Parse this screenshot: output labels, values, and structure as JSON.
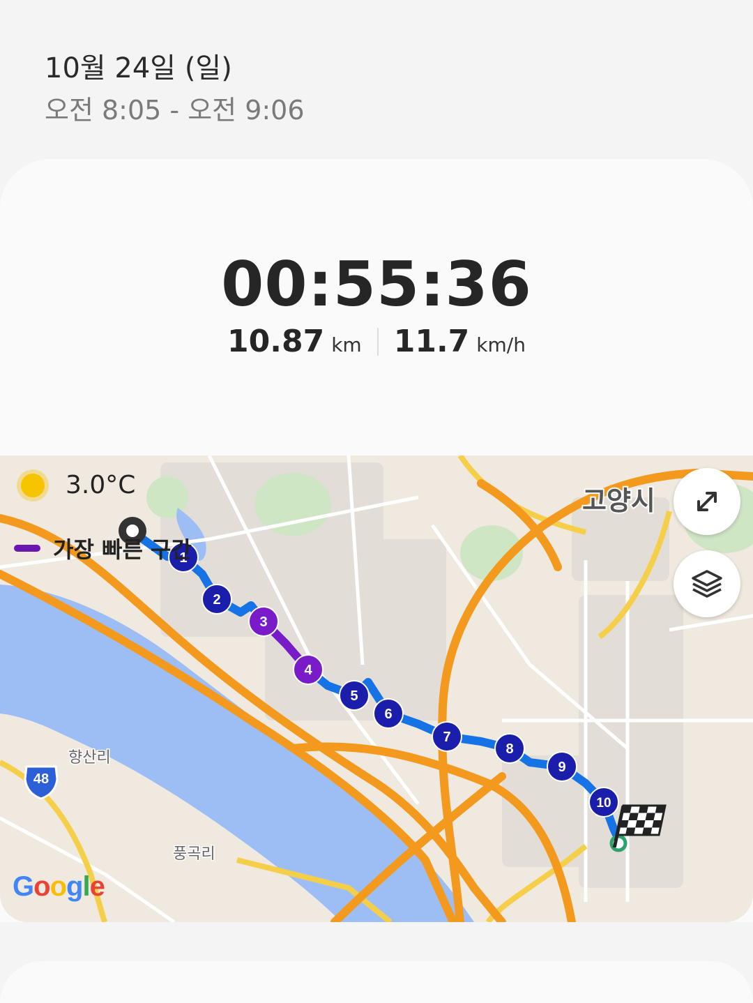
{
  "header": {
    "date": "10월 24일 (일)",
    "time_range": "오전 8:05 - 오전 9:06"
  },
  "summary": {
    "duration": "00:55:36",
    "distance_value": "10.87",
    "distance_unit": "km",
    "speed_value": "11.7",
    "speed_unit": "km/h"
  },
  "map": {
    "weather_icon": "sun-icon",
    "temperature": "3.0°C",
    "legend_label": "가장 빠른 구간",
    "legend_color": "#6a17b0",
    "route_color": "#1673e6",
    "fast_color": "#7a1bc9",
    "marker_color": "#1a1eaa",
    "place_labels": [
      "고양시",
      "향산리",
      "풍곡리"
    ],
    "road_badge": "48",
    "markers": [
      "1",
      "2",
      "3",
      "4",
      "5",
      "6",
      "7",
      "8",
      "9",
      "10"
    ],
    "fast_markers": [
      "3",
      "4"
    ],
    "expand_icon": "expand-icon",
    "layers_icon": "layers-icon",
    "finish_icon": "checkered-flag-icon",
    "start_icon": "start-pin-icon",
    "attribution": "Google"
  }
}
